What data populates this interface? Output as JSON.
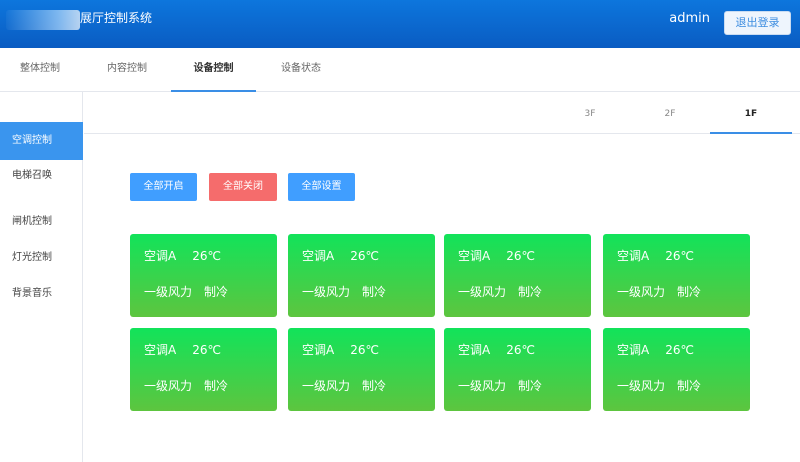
{
  "header": {
    "title": "展厅控制系统",
    "user": "admin",
    "logout_label": "退出登录"
  },
  "topnav": {
    "tabs": [
      {
        "label": "整体控制"
      },
      {
        "label": "内容控制"
      },
      {
        "label": "设备控制"
      },
      {
        "label": "设备状态"
      }
    ],
    "active": "设备控制"
  },
  "sidebar": {
    "items": [
      {
        "label": "空调控制"
      },
      {
        "label": "电梯召唤"
      },
      {
        "label": "闸机控制"
      },
      {
        "label": "灯光控制"
      },
      {
        "label": "背景音乐"
      }
    ],
    "active": "空调控制"
  },
  "floors": {
    "tabs": [
      {
        "label": "3F"
      },
      {
        "label": "2F"
      },
      {
        "label": "1F"
      }
    ],
    "active": "1F"
  },
  "actions": {
    "all_on": "全部开启",
    "all_off": "全部关闭",
    "all_settings": "全部设置"
  },
  "colors": {
    "header_blue": "#0a66cf",
    "accent_blue": "#3a95ee",
    "danger_red": "#f56c6c",
    "card_green_top": "#12e35a",
    "card_green_bottom": "#5dc53f"
  },
  "cards": [
    {
      "name": "空调A",
      "temp": "26℃",
      "fan": "一级风力",
      "mode": "制冷"
    },
    {
      "name": "空调A",
      "temp": "26℃",
      "fan": "一级风力",
      "mode": "制冷"
    },
    {
      "name": "空调A",
      "temp": "26℃",
      "fan": "一级风力",
      "mode": "制冷"
    },
    {
      "name": "空调A",
      "temp": "26℃",
      "fan": "一级风力",
      "mode": "制冷"
    },
    {
      "name": "空调A",
      "temp": "26℃",
      "fan": "一级风力",
      "mode": "制冷"
    },
    {
      "name": "空调A",
      "temp": "26℃",
      "fan": "一级风力",
      "mode": "制冷"
    },
    {
      "name": "空调A",
      "temp": "26℃",
      "fan": "一级风力",
      "mode": "制冷"
    },
    {
      "name": "空调A",
      "temp": "26℃",
      "fan": "一级风力",
      "mode": "制冷"
    }
  ]
}
